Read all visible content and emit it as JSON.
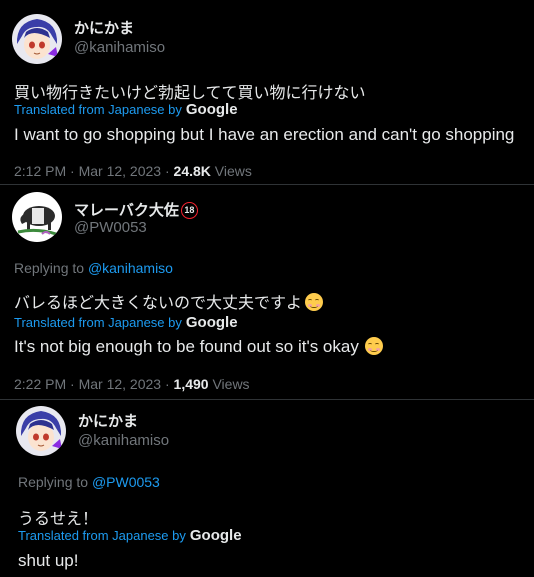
{
  "colors": {
    "background": "#000000",
    "text_primary": "#e7e9ea",
    "text_secondary": "#71767b",
    "accent": "#1d9bf0",
    "divider": "#2f3336"
  },
  "tweets": [
    {
      "avatar_icon": "anime-avatar-icon",
      "display_name": "かにかま",
      "handle": "@kanihamiso",
      "text": "買い物行きたいけど勃起してて買い物に行けない",
      "translated_from": "Translated from Japanese by",
      "translator": "Google",
      "translation": "I want to go shopping but I have an erection and can't go shopping",
      "time": "2:12 PM · Mar 12, 2023 · ",
      "views_count": "24.8K",
      "views_label": " Views"
    },
    {
      "avatar_icon": "tapir-avatar-icon",
      "display_name": "マレーバク大佐",
      "badge": "18",
      "handle": "@PW0053",
      "replying_label": "Replying to ",
      "replying_to": "@kanihamiso",
      "text": "バレるほど大きくないので大丈夫ですよ",
      "emoji_icon": "smiling-face-icon",
      "translated_from": "Translated from Japanese by",
      "translator": "Google",
      "translation": "It's not big enough to be found out so it's okay",
      "time": "2:22 PM · Mar 12, 2023 · ",
      "views_count": "1,490",
      "views_label": " Views"
    },
    {
      "avatar_icon": "anime-avatar-icon",
      "display_name": "かにかま",
      "handle": "@kanihamiso",
      "replying_label": "Replying to ",
      "replying_to": "@PW0053",
      "text": "うるせえ！",
      "translated_from": "Translated from Japanese by",
      "translator": "Google",
      "translation": "shut up!"
    }
  ]
}
